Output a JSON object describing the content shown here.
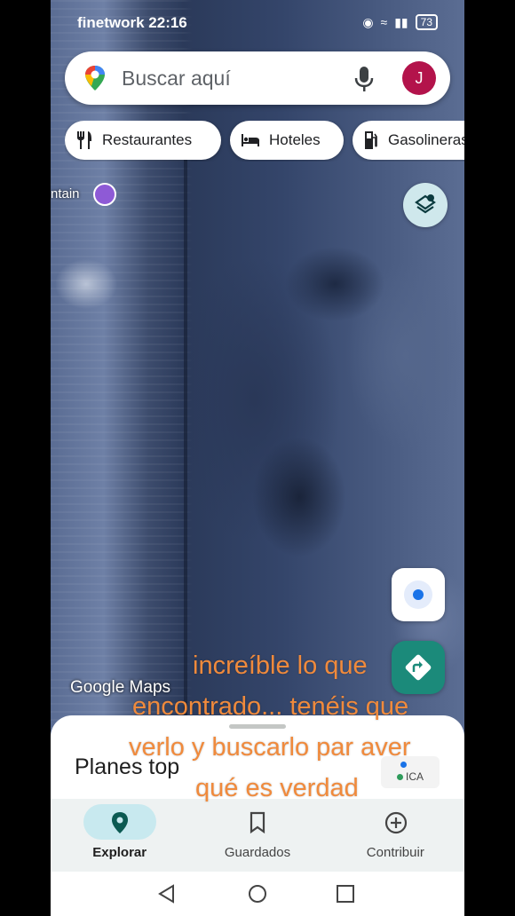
{
  "status_bar": {
    "carrier_time": "finetwork 22:16",
    "battery": "73"
  },
  "search": {
    "placeholder": "Buscar aquí",
    "avatar_initial": "J"
  },
  "chips": [
    {
      "label": "Restaurantes",
      "icon": "fork-knife-icon"
    },
    {
      "label": "Hoteles",
      "icon": "bed-icon"
    },
    {
      "label": "Gasolineras",
      "icon": "gas-station-icon"
    }
  ],
  "map": {
    "poi_label": "ntain",
    "logo": "Google Maps"
  },
  "sheet": {
    "title": "Planes top",
    "aqi_label": "ICA"
  },
  "tabs": [
    {
      "label": "Explorar",
      "icon": "location-pin-icon",
      "active": true
    },
    {
      "label": "Guardados",
      "icon": "bookmark-icon",
      "active": false
    },
    {
      "label": "Contribuir",
      "icon": "add-circle-icon",
      "active": false
    }
  ],
  "caption": {
    "lines": [
      "increíble lo que",
      "encontrado... tenéis que",
      "verlo y buscarlo par aver",
      "qué es verdad"
    ],
    "color": "#f08a3c"
  },
  "colors": {
    "accent": "#1b8a7a",
    "avatar": "#b3134b",
    "active_tab": "#c8e9ef"
  }
}
